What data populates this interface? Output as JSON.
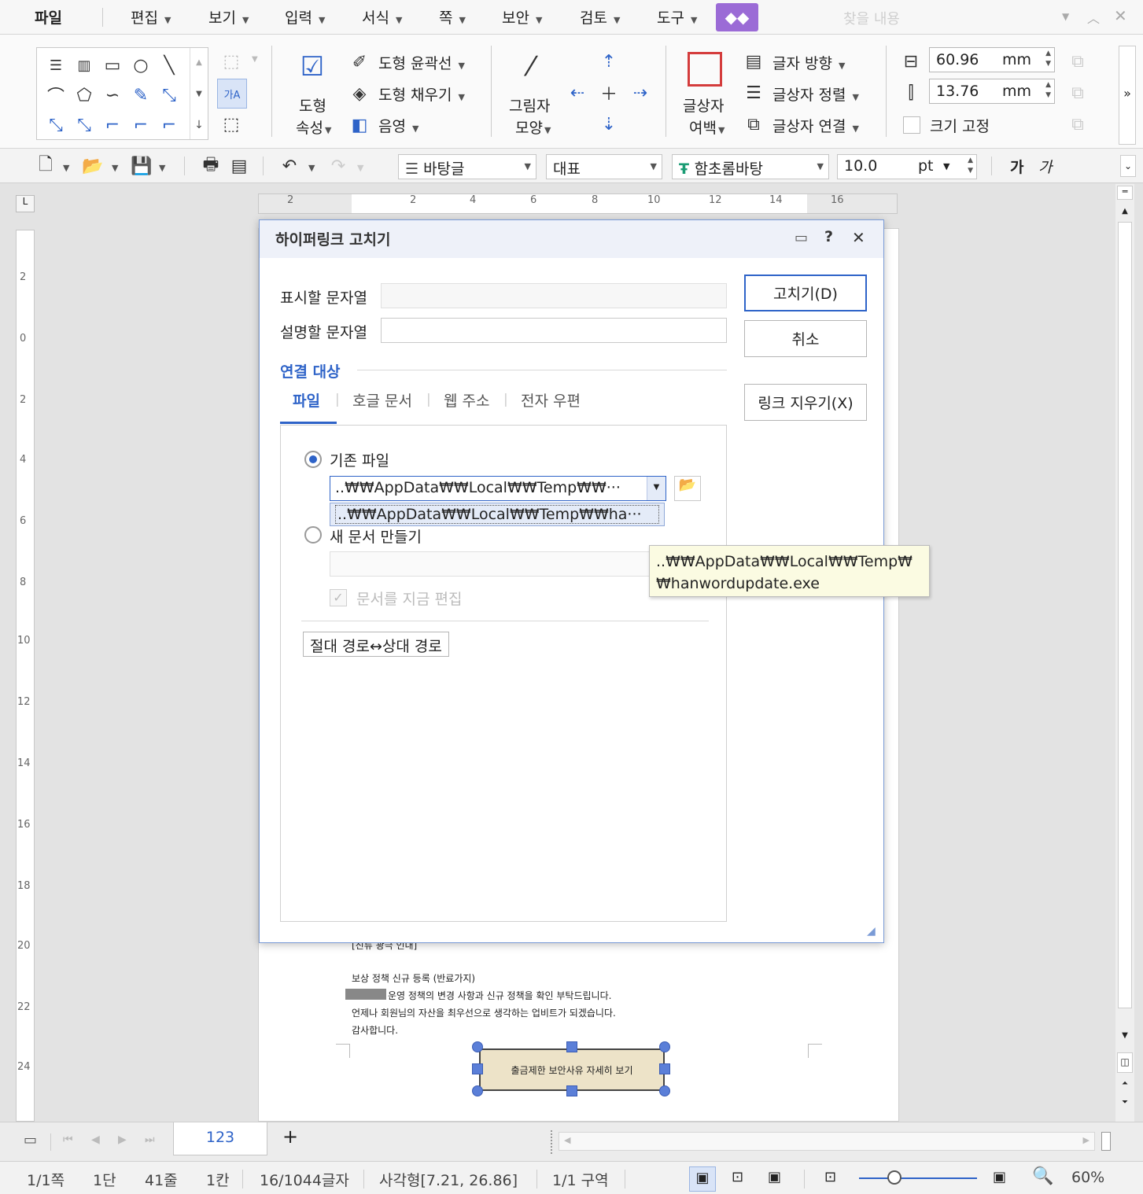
{
  "menu": {
    "items": [
      "파일",
      "편집",
      "보기",
      "입력",
      "서식",
      "쪽",
      "보안",
      "검토",
      "도구"
    ],
    "search_placeholder": "찾을 내용"
  },
  "ribbon": {
    "shape_props": "도형\n속성",
    "shape_props_l1": "도형",
    "shape_props_l2": "속성",
    "outline": "도형 윤곽선",
    "fill": "도형 채우기",
    "shadow": "음영",
    "shadow_shape_l1": "그림자",
    "shadow_shape_l2": "모양",
    "margin_l1": "글상자",
    "margin_l2": "여백",
    "text_dir": "글자 방향",
    "align": "글상자 정렬",
    "link": "글상자 연결",
    "width_value": "60.96",
    "height_value": "13.76",
    "unit": "mm",
    "fix_size": "크기 고정",
    "glyph_label": "가A"
  },
  "toolbar2": {
    "style": "바탕글",
    "lang": "대표",
    "font": "함초롬바탕",
    "size": "10.0",
    "size_unit": "pt",
    "bold": "가",
    "italic": "가"
  },
  "ruler": {
    "h": [
      "2",
      "2",
      "4",
      "6",
      "8",
      "10",
      "12",
      "14",
      "16"
    ],
    "v": [
      "2",
      "0",
      "2",
      "4",
      "6",
      "8",
      "10",
      "12",
      "14",
      "16",
      "18",
      "20",
      "22",
      "24"
    ]
  },
  "dialog": {
    "title": "하이퍼링크 고치기",
    "display_label": "표시할 문자열",
    "desc_label": "설명할 문자열",
    "display_value": "",
    "desc_value": "",
    "ok": "고치기(D)",
    "cancel": "취소",
    "remove_link": "링크 지우기(X)",
    "group_label": "연결 대상",
    "tabs": [
      "파일",
      "호글 문서",
      "웹 주소",
      "전자 우편"
    ],
    "existing_file": "기존 파일",
    "path_value": "..₩₩AppData₩₩Local₩₩Temp₩₩···",
    "dropdown_item": "..₩₩AppData₩₩Local₩₩Temp₩₩ha···",
    "new_doc": "새 문서 만들기",
    "edit_now": "문서를 지금 편집",
    "abs_rel": "절대 경로↔상대 경로"
  },
  "tooltip": {
    "line1": "..₩₩AppData₩₩Local₩₩Temp₩",
    "line2": "₩hanwordupdate.exe"
  },
  "document": {
    "line0": "[진류  광극  인내]",
    "line1": "보상 정책 신규 등록 (반료가지)",
    "line2": "운영 정책의 변경 사항과 신규 정책을 확인 부탁드립니다.",
    "line3": "언제나 회원님의 자산을 최우선으로 생각하는 업비트가 되겠습니다.",
    "line4": "감사합니다.",
    "button_text": "출금제한 보안사유 자세히 보기"
  },
  "tabbar": {
    "sheet": "123",
    "add": "+"
  },
  "status": {
    "page": "1/1쪽",
    "col": "1단",
    "line": "41줄",
    "cell": "1칸",
    "chars": "16/1044글자",
    "object": "사각형[7.21, 26.86]",
    "section": "1/1 구역",
    "zoom": "60%",
    "zoom_fraction": 0.3
  },
  "colors": {
    "accent": "#2e63c8",
    "dialog_border": "#7a9bd6",
    "tooltip_bg": "#fbfbe2",
    "shape_fill": "#ede3c8",
    "purple_button": "#9b6bd6"
  }
}
